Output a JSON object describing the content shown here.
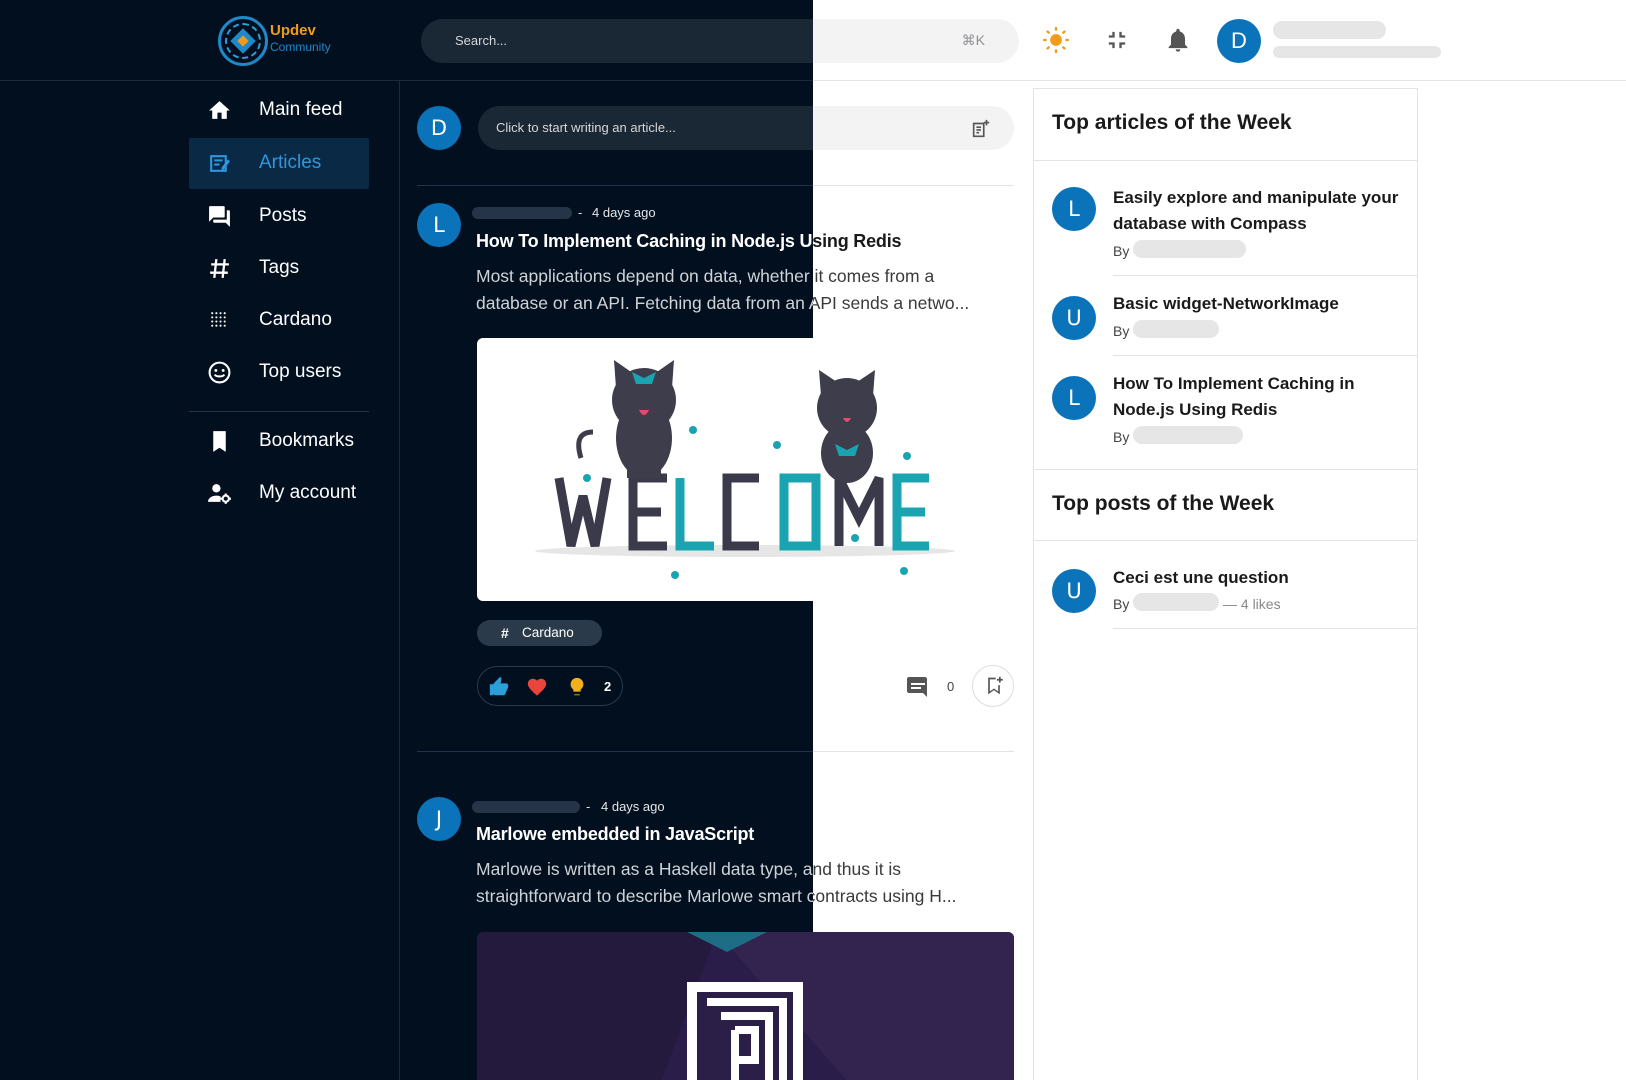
{
  "brand": {
    "name": "Updev",
    "sub": "Community"
  },
  "search": {
    "placeholder": "Search...",
    "shortcut": "⌘K"
  },
  "user": {
    "initial": "D"
  },
  "nav": [
    {
      "label": "Main feed",
      "icon": "home-icon"
    },
    {
      "label": "Articles",
      "icon": "articles-icon"
    },
    {
      "label": "Posts",
      "icon": "forum-icon"
    },
    {
      "label": "Tags",
      "icon": "hashtag-icon"
    },
    {
      "label": "Cardano",
      "icon": "cardano-icon"
    },
    {
      "label": "Top users",
      "icon": "smiley-icon"
    },
    {
      "label": "Bookmarks",
      "icon": "bookmark-icon"
    },
    {
      "label": "My account",
      "icon": "account-settings-icon"
    }
  ],
  "composer": {
    "placeholder": "Click to start writing an article..."
  },
  "feed": [
    {
      "avatar": "L",
      "time": "4 days ago",
      "title": "How To Implement Caching in Node.js Using Redis",
      "excerpt": "Most applications depend on data, whether it comes from a database or an API. Fetching data from an API sends a netwo...",
      "cover_text": "WELCOME",
      "tag": "Cardano",
      "reaction_count": "2",
      "comment_count": "0"
    },
    {
      "avatar": "J",
      "time": "4 days ago",
      "title": "Marlowe embedded in JavaScript",
      "excerpt": "Marlowe is written as a Haskell data type, and thus it is straightforward to describe Marlowe smart contracts using H..."
    }
  ],
  "top_articles": {
    "heading": "Top articles of the Week",
    "items": [
      {
        "avatar": "L",
        "title": "Easily explore and manipulate your database with Compass",
        "by": "By"
      },
      {
        "avatar": "U",
        "title": "Basic widget-NetworkImage",
        "by": "By"
      },
      {
        "avatar": "L",
        "title": "How To Implement Caching in Node.js Using Redis",
        "by": "By"
      }
    ]
  },
  "top_posts": {
    "heading": "Top posts of the Week",
    "items": [
      {
        "avatar": "U",
        "title": "Ceci est une question",
        "by": "By",
        "likes": "— 4 likes"
      }
    ]
  },
  "colors": {
    "brand_blue": "#0b73b9",
    "accent_orange": "#f29a1a",
    "dark_bg": "#010f1f",
    "active_nav": "#0a2944"
  }
}
